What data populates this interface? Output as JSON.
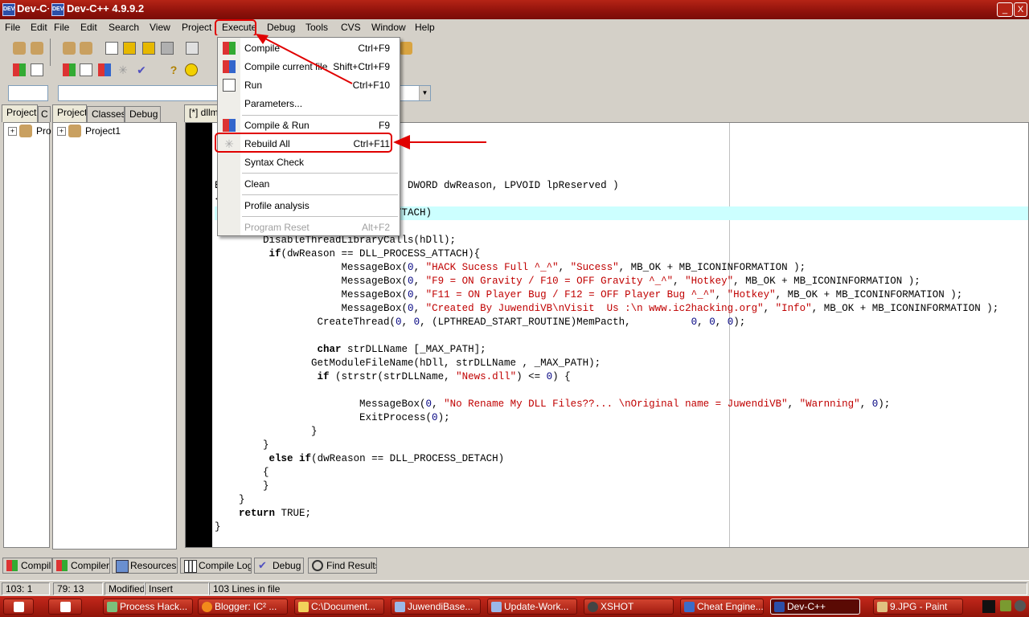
{
  "window": {
    "title_left": "Dev-C++",
    "title": "Dev-C++ 4.9.9.2",
    "buttons": [
      "_",
      "□",
      "X"
    ]
  },
  "menubar": {
    "items": [
      "File",
      "Edit",
      "File",
      "Edit",
      "Search",
      "View",
      "Project",
      "Execute",
      "Debug",
      "Tools",
      "CVS",
      "Window",
      "Help"
    ]
  },
  "left_tabs": {
    "outer": [
      "Project",
      "C"
    ],
    "inner": [
      "Project",
      "Classes",
      "Debug"
    ]
  },
  "project_tree": {
    "outer_item": "Pro",
    "inner_item": "Project1"
  },
  "editor_tab": "[*] dllma",
  "execute_menu": {
    "items": [
      {
        "label": "Compile",
        "shortcut": "Ctrl+F9",
        "icon": "compile-icon"
      },
      {
        "label": "Compile current file",
        "shortcut": "Shift+Ctrl+F9",
        "icon": "compile-file-icon"
      },
      {
        "label": "Run",
        "shortcut": "Ctrl+F10",
        "icon": "run-icon"
      },
      {
        "label": "Parameters...",
        "shortcut": ""
      },
      {
        "label": "Compile & Run",
        "shortcut": "F9",
        "icon": "compile-run-icon"
      },
      {
        "label": "Rebuild All",
        "shortcut": "Ctrl+F11",
        "icon": "rebuild-icon"
      },
      {
        "label": "Syntax Check",
        "shortcut": ""
      },
      {
        "label": "Clean",
        "shortcut": ""
      },
      {
        "label": "Profile analysis",
        "shortcut": ""
      },
      {
        "label": "Program Reset",
        "shortcut": "Alt+F2",
        "disabled": true
      }
    ]
  },
  "code": {
    "lines": [
      "",
      "",
      "",
      "",
      "B                         hDll, DWORD dwReason, LPVOID lpReserved )",
      "{",
      "                          SS_ATTACH)",
      "",
      "        DisableThreadLibraryCalls(hDll);",
      "         if(dwReason == DLL_PROCESS_ATTACH){",
      "                     MessageBox(0, \"HACK Sucess Full ^_^\", \"Sucess\", MB_OK + MB_ICONINFORMATION );",
      "                     MessageBox(0, \"F9 = ON Gravity / F10 = OFF Gravity ^_^\", \"Hotkey\", MB_OK + MB_ICONINFORMATION );",
      "                     MessageBox(0, \"F11 = ON Player Bug / F12 = OFF Player Bug ^_^\", \"Hotkey\", MB_OK + MB_ICONINFORMATION );",
      "                     MessageBox(0, \"Created By JuwendiVB\\nVisit  Us :\\n www.ic2hacking.org\", \"Info\", MB_OK + MB_ICONINFORMATION );",
      "                 CreateThread(0, 0, (LPTHREAD_START_ROUTINE)MemPacth,          0, 0, 0);",
      "",
      "                 char strDLLName [_MAX_PATH];",
      "                GetModuleFileName(hDll, strDLLName , _MAX_PATH);",
      "                 if (strstr(strDLLName, \"News.dll\") <= 0) {",
      "",
      "                        MessageBox(0, \"No Rename My DLL Files??... \\nOriginal name = JuwendiVB\", \"Warnning\", 0);",
      "                        ExitProcess(0);",
      "                }",
      "        }",
      "         else if(dwReason == DLL_PROCESS_DETACH)",
      "        {",
      "        }",
      "    }",
      "    return TRUE;",
      "}"
    ]
  },
  "bottom_tabs": [
    "Compil",
    "Compiler",
    "Resources",
    "Compile Log",
    "Debug",
    "Find Results"
  ],
  "statusbar": {
    "pos1": "103: 1",
    "pos2": "79: 13",
    "modified": "Modified",
    "mode": "Insert",
    "lines": "103 Lines in file"
  },
  "taskbar": {
    "items": [
      "Process Hack...",
      "Blogger: IC² ...",
      "C:\\Document...",
      "JuwendiBase...",
      "Update-Work...",
      "XSHOT",
      "Cheat Engine...",
      "Dev-C++",
      "9.JPG - Paint"
    ]
  },
  "colors": {
    "titlebar": "#9a160d",
    "annotation": "#e00000",
    "string": "#c00000",
    "highlight_line": "#ccffff"
  }
}
